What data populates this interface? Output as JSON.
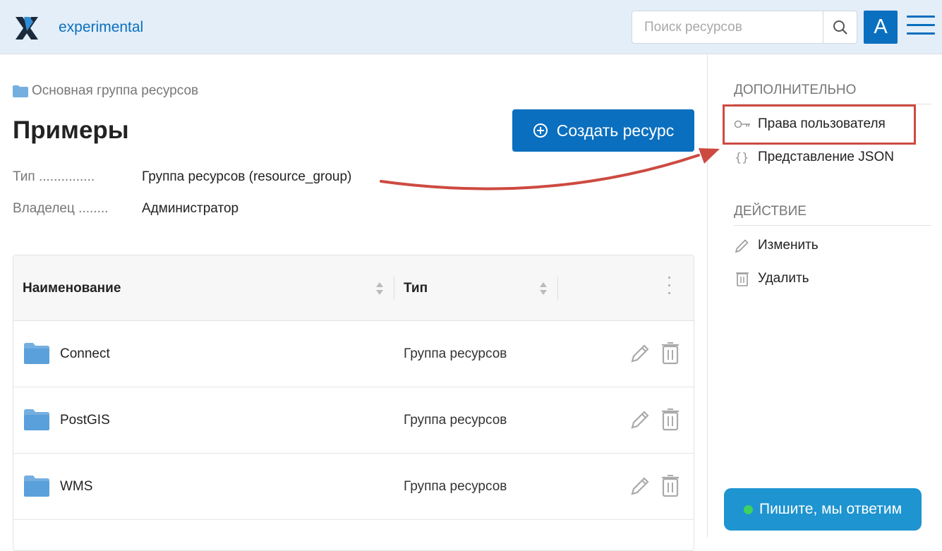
{
  "header": {
    "app_title": "experimental",
    "search_placeholder": "Поиск ресурсов",
    "avatar_letter": "A",
    "brand_color": "#0b6fbf"
  },
  "breadcrumb": {
    "label": "Основная группа ресурсов"
  },
  "page": {
    "title": "Примеры",
    "create_button": "Создать ресурс"
  },
  "properties": [
    {
      "key": "Тип",
      "value": "Группа ресурсов (resource_group)"
    },
    {
      "key": "Владелец",
      "value": "Администратор"
    }
  ],
  "table": {
    "columns": [
      "Наименование",
      "Тип"
    ],
    "rows": [
      {
        "name": "Connect",
        "type": "Группа ресурсов"
      },
      {
        "name": "PostGIS",
        "type": "Группа ресурсов"
      },
      {
        "name": "WMS",
        "type": "Группа ресурсов"
      }
    ]
  },
  "sidebar": {
    "extra_title": "ДОПОЛНИТЕЛЬНО",
    "extra_items": [
      {
        "label": "Права пользователя",
        "icon": "key-icon"
      },
      {
        "label": "Представление JSON",
        "icon": "braces-icon"
      }
    ],
    "action_title": "ДЕЙСТВИЕ",
    "action_items": [
      {
        "label": "Изменить",
        "icon": "pencil-icon"
      },
      {
        "label": "Удалить",
        "icon": "trash-icon"
      }
    ]
  },
  "chat": {
    "label": "Пишите, мы ответим",
    "status_color": "#3ed15f"
  },
  "annotation": {
    "color": "#cd4a41"
  }
}
